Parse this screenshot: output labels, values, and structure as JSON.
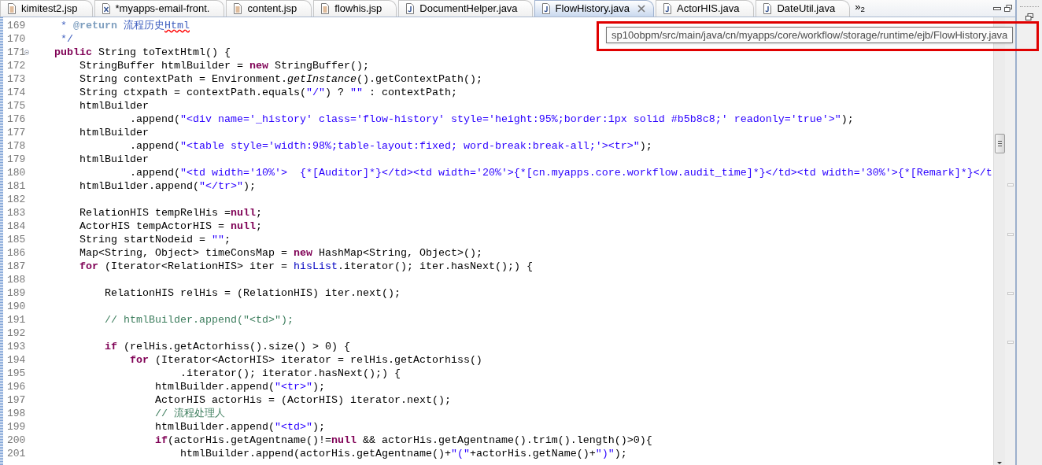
{
  "tabs": [
    {
      "label": "kimitest2.jsp",
      "kind": "jsp",
      "selected": false
    },
    {
      "label": "*myapps-email-front.",
      "kind": "xml",
      "selected": false
    },
    {
      "label": "content.jsp",
      "kind": "jsp",
      "selected": false
    },
    {
      "label": "flowhis.jsp",
      "kind": "jsp",
      "selected": false
    },
    {
      "label": "DocumentHelper.java",
      "kind": "java",
      "selected": false
    },
    {
      "label": "FlowHistory.java",
      "kind": "java",
      "selected": true
    },
    {
      "label": "ActorHIS.java",
      "kind": "java",
      "selected": false
    },
    {
      "label": "DateUtil.java",
      "kind": "java",
      "selected": false
    }
  ],
  "tab_overflow": "»$_{2}$",
  "tooltip": {
    "text": "sp10obpm/src/main/java/cn/myapps/core/workflow/storage/runtime/ejb/FlowHistory.java"
  },
  "editor": {
    "lines": [
      {
        "number": "169",
        "fold": false,
        "segments": [
          {
            "kind": "javadoc",
            "text": "     * "
          },
          {
            "kind": "tag",
            "text": "@return"
          },
          {
            "kind": "javadoc",
            "text": " 流程历史"
          },
          {
            "kind": "misspelled",
            "text": "Html"
          }
        ]
      },
      {
        "number": "170",
        "fold": false,
        "segments": [
          {
            "kind": "javadoc",
            "text": "     */"
          }
        ]
      },
      {
        "number": "171",
        "fold": true,
        "segments": [
          {
            "kind": "keyword",
            "text": "    public"
          },
          {
            "kind": "plain",
            "text": " String toTextHtml() {"
          }
        ]
      },
      {
        "number": "172",
        "fold": false,
        "segments": [
          {
            "kind": "plain",
            "text": "        StringBuffer htmlBuilder = "
          },
          {
            "kind": "keyword",
            "text": "new"
          },
          {
            "kind": "plain",
            "text": " StringBuffer();"
          }
        ]
      },
      {
        "number": "173",
        "fold": false,
        "segments": [
          {
            "kind": "plain",
            "text": "        String contextPath = Environment."
          },
          {
            "kind": "static",
            "text": "getInstance"
          },
          {
            "kind": "plain",
            "text": "().getContextPath();"
          }
        ]
      },
      {
        "number": "174",
        "fold": false,
        "segments": [
          {
            "kind": "plain",
            "text": "        String ctxpath = contextPath.equals("
          },
          {
            "kind": "string",
            "text": "\"/\""
          },
          {
            "kind": "plain",
            "text": ") ? "
          },
          {
            "kind": "string",
            "text": "\"\""
          },
          {
            "kind": "plain",
            "text": " : contextPath;"
          }
        ]
      },
      {
        "number": "175",
        "fold": false,
        "segments": [
          {
            "kind": "plain",
            "text": "        htmlBuilder"
          }
        ]
      },
      {
        "number": "176",
        "fold": false,
        "segments": [
          {
            "kind": "plain",
            "text": "                .append("
          },
          {
            "kind": "string",
            "text": "\"<div name='_history' class='flow-history' style='height:95%;border:1px solid #b5b8c8;' readonly='true'>\""
          },
          {
            "kind": "plain",
            "text": ");"
          }
        ]
      },
      {
        "number": "177",
        "fold": false,
        "segments": [
          {
            "kind": "plain",
            "text": "        htmlBuilder"
          }
        ]
      },
      {
        "number": "178",
        "fold": false,
        "segments": [
          {
            "kind": "plain",
            "text": "                .append("
          },
          {
            "kind": "string",
            "text": "\"<table style='width:98%;table-layout:fixed; word-break:break-all;'><tr>\""
          },
          {
            "kind": "plain",
            "text": ");"
          }
        ]
      },
      {
        "number": "179",
        "fold": false,
        "segments": [
          {
            "kind": "plain",
            "text": "        htmlBuilder"
          }
        ]
      },
      {
        "number": "180",
        "fold": false,
        "segments": [
          {
            "kind": "plain",
            "text": "                .append("
          },
          {
            "kind": "string",
            "text": "\"<td width='10%'>  {*[Auditor]*}</td><td width='20%'>{*[cn.myapps.core.workflow.audit_time]*}</td><td width='30%'>{*[Remark]*}</t"
          }
        ]
      },
      {
        "number": "181",
        "fold": false,
        "segments": [
          {
            "kind": "plain",
            "text": "        htmlBuilder.append("
          },
          {
            "kind": "string",
            "text": "\"</tr>\""
          },
          {
            "kind": "plain",
            "text": ");"
          }
        ]
      },
      {
        "number": "182",
        "fold": false
      },
      {
        "number": "183",
        "fold": false,
        "segments": [
          {
            "kind": "plain",
            "text": "        RelationHIS tempRelHis ="
          },
          {
            "kind": "keyword",
            "text": "null"
          },
          {
            "kind": "plain",
            "text": ";"
          }
        ]
      },
      {
        "number": "184",
        "fold": false,
        "segments": [
          {
            "kind": "plain",
            "text": "        ActorHIS tempActorHIS = "
          },
          {
            "kind": "keyword",
            "text": "null"
          },
          {
            "kind": "plain",
            "text": ";"
          }
        ]
      },
      {
        "number": "185",
        "fold": false,
        "segments": [
          {
            "kind": "plain",
            "text": "        String startNodeid = "
          },
          {
            "kind": "string",
            "text": "\"\""
          },
          {
            "kind": "plain",
            "text": ";"
          }
        ]
      },
      {
        "number": "186",
        "fold": false,
        "segments": [
          {
            "kind": "plain",
            "text": "        Map<String, Object> timeConsMap = "
          },
          {
            "kind": "keyword",
            "text": "new"
          },
          {
            "kind": "plain",
            "text": " HashMap<String, Object>();"
          }
        ]
      },
      {
        "number": "187",
        "fold": false,
        "segments": [
          {
            "kind": "keyword",
            "text": "        for"
          },
          {
            "kind": "plain",
            "text": " (Iterator<RelationHIS> iter = "
          },
          {
            "kind": "field",
            "text": "hisList"
          },
          {
            "kind": "plain",
            "text": ".iterator(); iter.hasNext();) {"
          }
        ]
      },
      {
        "number": "188",
        "fold": false
      },
      {
        "number": "189",
        "fold": false,
        "segments": [
          {
            "kind": "plain",
            "text": "            RelationHIS relHis = (RelationHIS) iter.next();"
          }
        ]
      },
      {
        "number": "190",
        "fold": false
      },
      {
        "number": "191",
        "fold": false,
        "segments": [
          {
            "kind": "comment",
            "text": "            // htmlBuilder.append(\"<td>\");"
          }
        ]
      },
      {
        "number": "192",
        "fold": false
      },
      {
        "number": "193",
        "fold": false,
        "segments": [
          {
            "kind": "keyword",
            "text": "            if"
          },
          {
            "kind": "plain",
            "text": " (relHis.getActorhiss().size() > 0) {"
          }
        ]
      },
      {
        "number": "194",
        "fold": false,
        "segments": [
          {
            "kind": "keyword",
            "text": "                for"
          },
          {
            "kind": "plain",
            "text": " (Iterator<ActorHIS> iterator = relHis.getActorhiss()"
          }
        ]
      },
      {
        "number": "195",
        "fold": false,
        "segments": [
          {
            "kind": "plain",
            "text": "                        .iterator(); iterator.hasNext();) {"
          }
        ]
      },
      {
        "number": "196",
        "fold": false,
        "segments": [
          {
            "kind": "plain",
            "text": "                    htmlBuilder.append("
          },
          {
            "kind": "string",
            "text": "\"<tr>\""
          },
          {
            "kind": "plain",
            "text": ");"
          }
        ]
      },
      {
        "number": "197",
        "fold": false,
        "segments": [
          {
            "kind": "plain",
            "text": "                    ActorHIS actorHis = (ActorHIS) iterator.next();"
          }
        ]
      },
      {
        "number": "198",
        "fold": false,
        "segments": [
          {
            "kind": "comment",
            "text": "                    // 流程处理人"
          }
        ]
      },
      {
        "number": "199",
        "fold": false,
        "segments": [
          {
            "kind": "plain",
            "text": "                    htmlBuilder.append("
          },
          {
            "kind": "string",
            "text": "\"<td>\""
          },
          {
            "kind": "plain",
            "text": ");"
          }
        ]
      },
      {
        "number": "200",
        "fold": false,
        "segments": [
          {
            "kind": "keyword",
            "text": "                    if"
          },
          {
            "kind": "plain",
            "text": "(actorHis.getAgentname()!="
          },
          {
            "kind": "keyword",
            "text": "null"
          },
          {
            "kind": "plain",
            "text": " && actorHis.getAgentname().trim().length()>0){"
          }
        ]
      },
      {
        "number": "201",
        "fold": false,
        "segments": [
          {
            "kind": "plain",
            "text": "                        htmlBuilder.append(actorHis.getAgentname()+"
          },
          {
            "kind": "string",
            "text": "\"(\""
          },
          {
            "kind": "plain",
            "text": "+actorHis.getName()+"
          },
          {
            "kind": "string",
            "text": "\")\""
          },
          {
            "kind": "plain",
            "text": ");"
          }
        ]
      }
    ]
  }
}
